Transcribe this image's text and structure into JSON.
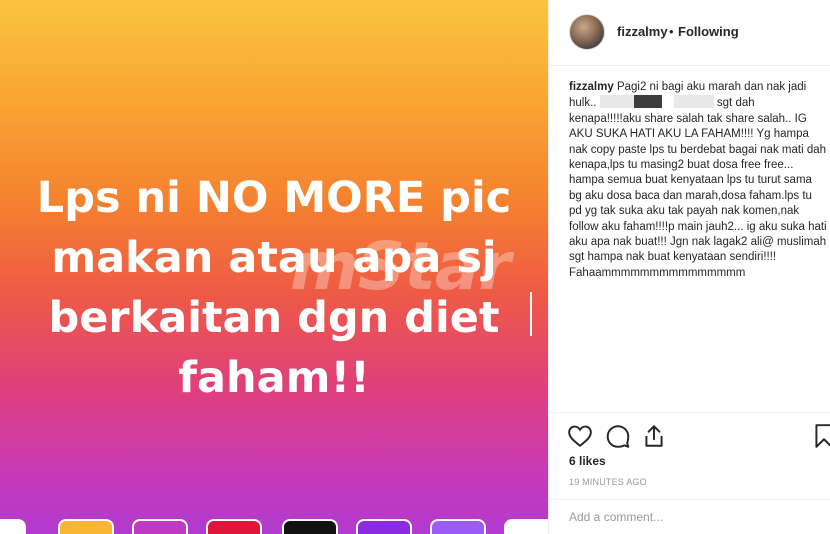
{
  "post": {
    "image_text": [
      "Lps ni NO MORE pic",
      "makan atau apa sj",
      "berkaitan dgn diet",
      "faham!!"
    ],
    "watermark": "mStar",
    "swatch_colors": [
      "#ffffff",
      "#f7b733",
      "#c13ac4",
      "#e0153b",
      "#111111",
      "#8a2be2",
      "#9a5cf5",
      "#ffffff"
    ]
  },
  "header": {
    "username": "fizzalmy",
    "separator": "•",
    "follow_status": "Following"
  },
  "caption": {
    "username": "fizzalmy",
    "text_part1": "Pagi2 ni bagi aku marah dan nak jadi hulk..",
    "text_part2": "sgt dah kenapa!!!!!aku share salah tak share salah.. IG AKU SUKA HATI AKU LA FAHAM!!!! Yg hampa nak copy paste lps tu berdebat bagai nak mati dah kenapa,lps tu masing2 buat dosa free free... hampa semua buat kenyataan lps tu turut sama bg aku dosa baca dan marah,dosa faham.lps tu pd yg tak suka aku tak payah nak komen,nak follow aku faham!!!!p main jauh2... ig aku suka hati aku apa nak buat!!! Jgn nak lagak2 ali@ muslimah sgt hampa nak buat kenyataan sendiri!!!! Fahaammmmmmmmmmmmmmm"
  },
  "actions": {
    "icons": [
      "heart-icon",
      "comment-icon",
      "share-icon",
      "bookmark-icon"
    ]
  },
  "likes": "6 likes",
  "timestamp": "19 MINUTES AGO",
  "comment": {
    "placeholder": "Add a comment..."
  }
}
